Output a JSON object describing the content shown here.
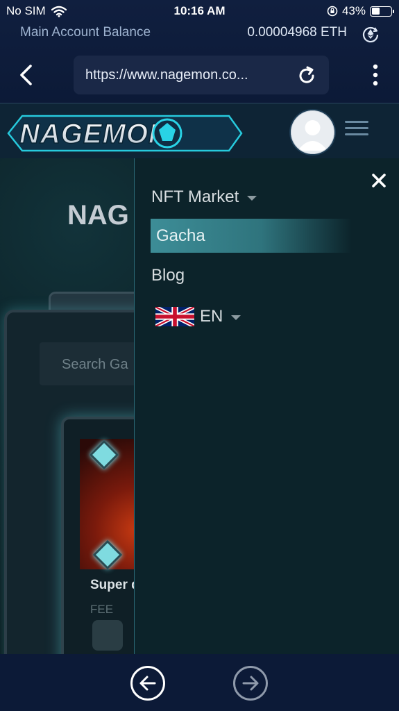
{
  "status_bar": {
    "carrier": "No SIM",
    "time": "10:16 AM",
    "battery_percent": "43%",
    "battery_level": 0.43,
    "icons": [
      "wifi-icon",
      "orientation-lock-icon",
      "battery-icon"
    ]
  },
  "wallet": {
    "balance_label": "Main Account Balance",
    "balance_value": "0.00004968 ETH",
    "refresh_icon": "eth-refresh-icon"
  },
  "browser": {
    "url": "https://www.nagemon.co...",
    "back_icon": "chevron-left-icon",
    "reload_icon": "reload-icon",
    "more_icon": "more-vertical-icon"
  },
  "site": {
    "logo_text": "NAGEMON",
    "avatar_icon": "user-avatar-icon",
    "menu_icon": "hamburger-icon"
  },
  "page": {
    "title_partial": "NAG",
    "search_placeholder": "Search Ga",
    "card_title": "Super d",
    "card_fee_label": "FEE"
  },
  "menu": {
    "close_icon": "close-icon",
    "items": [
      {
        "label": "NFT Market",
        "has_dropdown": true
      },
      {
        "label": "Gacha",
        "active": true
      },
      {
        "label": "Blog"
      }
    ],
    "language": {
      "label": "EN",
      "flag": "uk-flag-icon"
    }
  },
  "bottom_nav": {
    "back_icon": "arrow-left-circle-icon",
    "forward_icon": "arrow-right-circle-icon"
  },
  "colors": {
    "wallet_bg": "#0c1a37",
    "menu_bg": "#0c232a",
    "active_item": "#3d8d97",
    "logo_accent": "#29d3e6"
  }
}
